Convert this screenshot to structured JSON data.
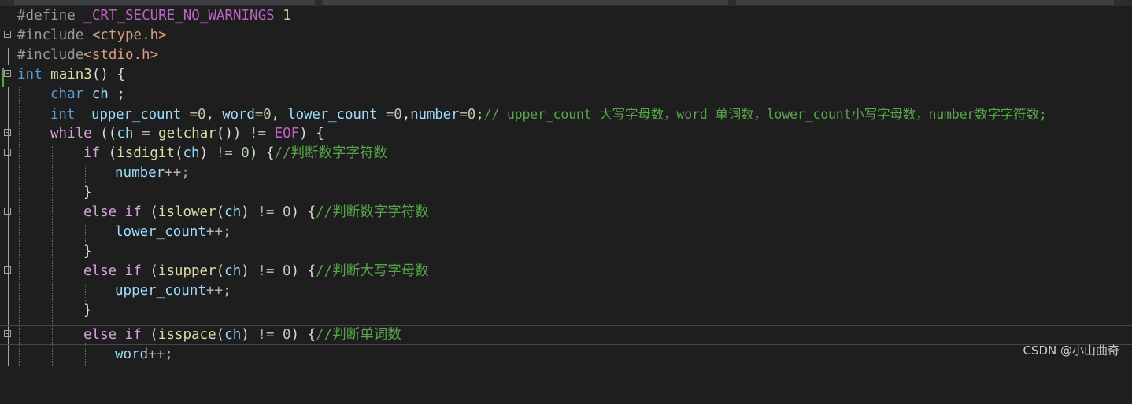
{
  "editor": {
    "lines": [
      {
        "text": "#define _CRT_SECURE_NO_WARNINGS 1"
      },
      {
        "text": "#include <ctype.h>"
      },
      {
        "text": "#include<stdio.h>"
      },
      {
        "text": "int main3() {"
      },
      {
        "text": "    char ch ;"
      },
      {
        "text": "    int  upper_count =0, word=0, lower_count =0,number=0;// upper_count 大写字母数，word 单词数，lower_count小写字母数，number数字字符数;"
      },
      {
        "text": "    while ((ch = getchar()) != EOF) {"
      },
      {
        "text": "        if (isdigit(ch) != 0) {//判断数字字符数"
      },
      {
        "text": "            number++;"
      },
      {
        "text": "        }"
      },
      {
        "text": "        else if (islower(ch) != 0) {//判断数字字符数"
      },
      {
        "text": "            lower_count++;"
      },
      {
        "text": "        }"
      },
      {
        "text": "        else if (isupper(ch) != 0) {//判断大写字母数"
      },
      {
        "text": "            upper_count++;"
      },
      {
        "text": "        }"
      },
      {
        "text": "        else if (isspace(ch) != 0) {//判断单词数"
      },
      {
        "text": "            word++;"
      }
    ]
  },
  "tokens": {
    "define_kw": "#define",
    "define_name": "_CRT_SECURE_NO_WARNINGS",
    "define_val": "1",
    "include1_kw": "#include",
    "include1_file": "<ctype.h>",
    "include2_kw": "#include",
    "include2_file": "<stdio.h>",
    "int_kw": "int",
    "main_name": "main3",
    "main_tail": "() {",
    "char_kw": "char",
    "ch_decl": "ch",
    "ch_semi": ";",
    "int_kw2": "int",
    "v_upper": "upper_count",
    "a1": "=",
    "n0a": "0",
    "c1": ",",
    "v_word": "word",
    "a2": "=",
    "n0b": "0",
    "c2": ",",
    "v_lower": "lower_count",
    "a3": "=",
    "n0c": "0",
    "c3": ",",
    "v_number": "number",
    "a4": "=",
    "n0d": "0",
    "semi1": ";",
    "comment1": "// upper_count 大写字母数，word 单词数，lower_count小写字母数，number数字字符数;",
    "while_kw": "while",
    "w_p1": "((",
    "w_ch": "ch",
    "w_eq": "=",
    "w_getchar": "getchar",
    "w_p2": "())",
    "w_ne": "!=",
    "w_eof": "EOF",
    "w_end": ") {",
    "if1_kw": "if",
    "if1_open": "(",
    "if1_fn": "isdigit",
    "if1_p": "(",
    "if1_ch": "ch",
    "if1_close": ")",
    "if1_ne": "!=",
    "if1_zero": "0",
    "if1_end": ") {",
    "if1_cm": "//判断数字字符数",
    "number_inc_v": "number",
    "number_inc_op": "++;",
    "rbrace1": "}",
    "elseif2_kw": "else if",
    "if2_open": "(",
    "if2_fn": "islower",
    "if2_p": "(",
    "if2_ch": "ch",
    "if2_close": ")",
    "if2_ne": "!=",
    "if2_zero": "0",
    "if2_end": ") {",
    "if2_cm": "//判断数字字符数",
    "lower_inc_v": "lower_count",
    "lower_inc_op": "++;",
    "rbrace2": "}",
    "elseif3_kw": "else if",
    "if3_open": "(",
    "if3_fn": "isupper",
    "if3_p": "(",
    "if3_ch": "ch",
    "if3_close": ")",
    "if3_ne": "!=",
    "if3_zero": "0",
    "if3_end": ") {",
    "if3_cm": "//判断大写字母数",
    "upper_inc_v": "upper_count",
    "upper_inc_op": "++;",
    "rbrace3": "}",
    "elseif4_kw": "else if",
    "if4_open": "(",
    "if4_fn": "isspace",
    "if4_p": "(",
    "if4_ch": "ch",
    "if4_close": ")",
    "if4_ne": "!=",
    "if4_zero": "0",
    "if4_end": ") {",
    "if4_cm": "//判断单词数",
    "word_inc_v": "word",
    "word_inc_op": "++;"
  },
  "watermark": "CSDN @小山曲奇",
  "colors": {
    "background": "#1e1e1e",
    "keyword": "#569cd6",
    "preprocessor": "#9b9b9b",
    "include_file": "#d69d85",
    "macro": "#bd63c5",
    "function": "#dcdcaa",
    "variable": "#9cdcfe",
    "number": "#b5cea8",
    "comment": "#57a64a",
    "control_keyword": "#d8a0df"
  }
}
